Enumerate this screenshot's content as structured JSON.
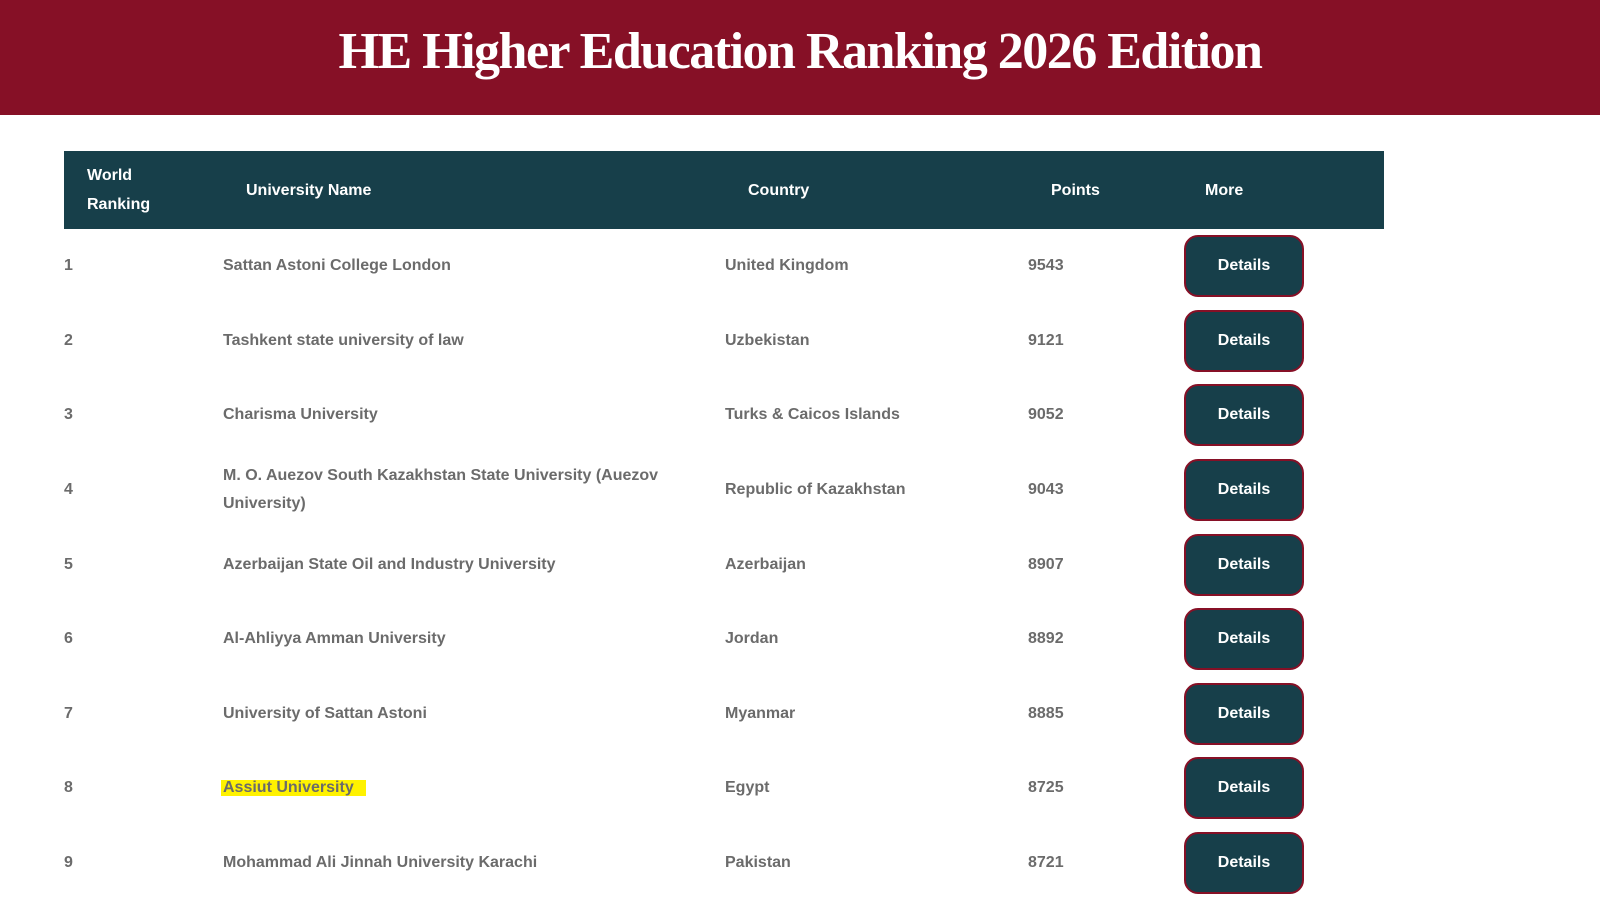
{
  "header": {
    "title": "HE Higher Education Ranking 2026 Edition"
  },
  "table": {
    "columns": {
      "rank_line1": "World",
      "rank_line2": "Ranking",
      "name": "University Name",
      "country": "Country",
      "points": "Points",
      "more": "More"
    },
    "rows": [
      {
        "rank": "1",
        "name": "Sattan Astoni College London",
        "country": "United Kingdom",
        "points": "9543",
        "button": "Details"
      },
      {
        "rank": "2",
        "name": "Tashkent state university of law",
        "country": "Uzbekistan",
        "points": "9121",
        "button": "Details"
      },
      {
        "rank": "3",
        "name": "Charisma University",
        "country": "Turks & Caicos Islands",
        "points": "9052",
        "button": "Details"
      },
      {
        "rank": "4",
        "name": "M. O. Auezov South Kazakhstan State University (Auezov University)",
        "country": "Republic of Kazakhstan",
        "points": "9043",
        "button": "Details"
      },
      {
        "rank": "5",
        "name": "Azerbaijan State Oil and Industry University",
        "country": "Azerbaijan",
        "points": "8907",
        "button": "Details"
      },
      {
        "rank": "6",
        "name": "Al-Ahliyya Amman University",
        "country": "Jordan",
        "points": "8892",
        "button": "Details"
      },
      {
        "rank": "7",
        "name": "University of Sattan Astoni",
        "country": "Myanmar",
        "points": "8885",
        "button": "Details"
      },
      {
        "rank": "8",
        "name": "Assiut University",
        "country": "Egypt",
        "points": "8725",
        "button": "Details",
        "highlighted": true
      },
      {
        "rank": "9",
        "name": "Mohammad Ali Jinnah University Karachi",
        "country": "Pakistan",
        "points": "8721",
        "button": "Details"
      }
    ]
  },
  "colors": {
    "header_bg": "#861026",
    "table_header_bg": "#173f4a",
    "button_bg": "#173f4a",
    "button_border": "#861026",
    "highlight": "#fff200",
    "row_text": "#6b6b6b"
  }
}
